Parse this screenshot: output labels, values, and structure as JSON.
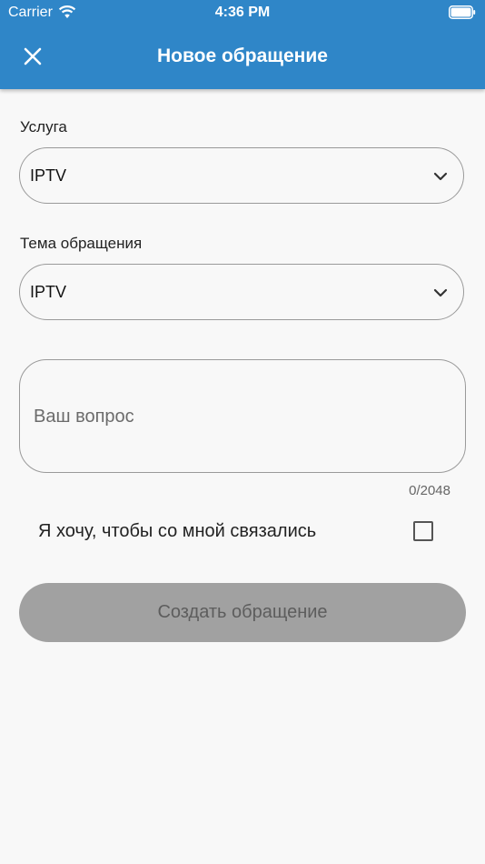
{
  "status_bar": {
    "carrier": "Carrier",
    "time": "4:36 PM"
  },
  "header": {
    "title": "Новое обращение",
    "close_icon": "close-icon"
  },
  "form": {
    "service": {
      "label": "Услуга",
      "value": "IPTV"
    },
    "topic": {
      "label": "Тема обращения",
      "value": "IPTV"
    },
    "question": {
      "placeholder": "Ваш вопрос",
      "counter": "0/2048"
    },
    "contact_me": {
      "label": "Я хочу, чтобы со мной связались",
      "checked": false
    },
    "submit_label": "Создать обращение"
  },
  "colors": {
    "accent": "#2f86c8",
    "background": "#f8f8f8",
    "button_disabled": "#a1a1a1"
  }
}
